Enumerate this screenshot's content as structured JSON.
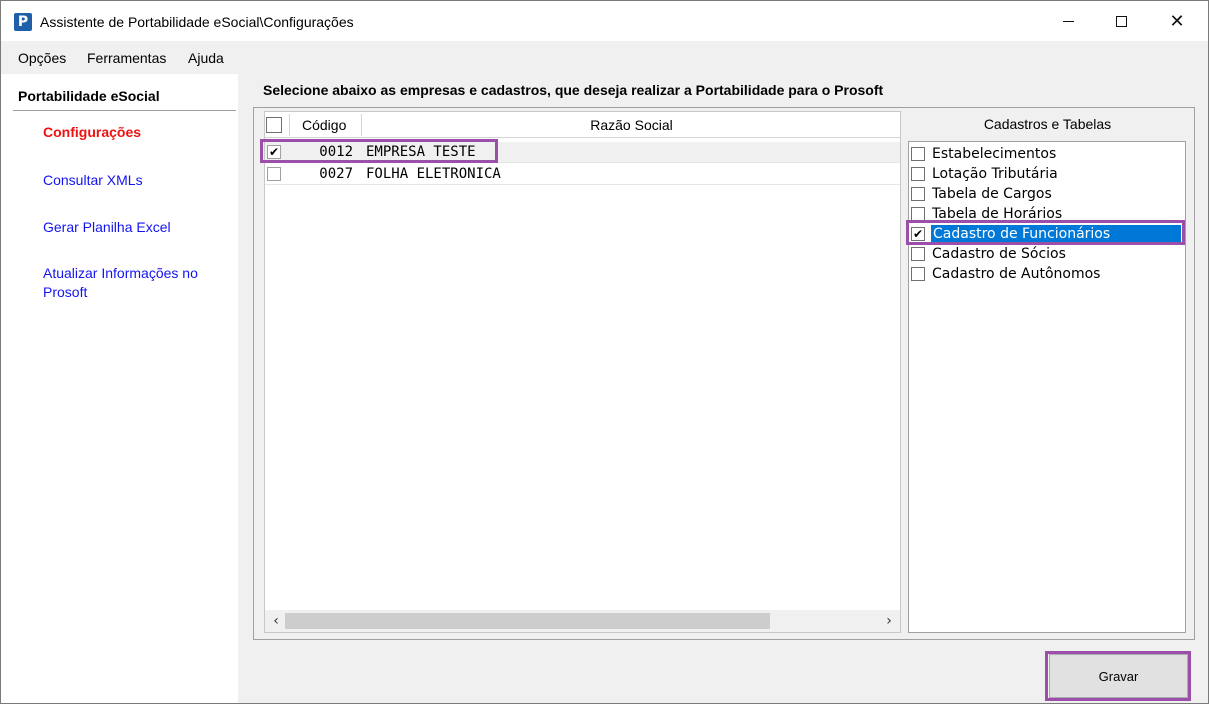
{
  "window": {
    "title": "Assistente de Portabilidade eSocial\\Configurações",
    "icon": "P",
    "close_glyph": "✕"
  },
  "menu": [
    "Opções",
    "Ferramentas",
    "Ajuda"
  ],
  "sidebar": {
    "header": "Portabilidade eSocial",
    "items": [
      {
        "label": "Configurações",
        "active": true
      },
      {
        "label": "Consultar XMLs",
        "active": false
      },
      {
        "label": "Gerar Planilha Excel",
        "active": false
      },
      {
        "label": "Atualizar Informações no Prosoft",
        "active": false
      }
    ]
  },
  "main": {
    "instruction": "Selecione abaixo as empresas e cadastros, que deseja realizar a Portabilidade para o Prosoft",
    "grid": {
      "columns": [
        "Código",
        "Razão Social"
      ],
      "rows": [
        {
          "checked": true,
          "codigo": "0012",
          "razao": "EMPRESA TESTE"
        },
        {
          "checked": false,
          "codigo": "0027",
          "razao": "FOLHA ELETRONICA"
        }
      ],
      "scroll_left": "‹",
      "scroll_right": "›"
    },
    "cadastros": {
      "title": "Cadastros e Tabelas",
      "items": [
        {
          "label": "Estabelecimentos",
          "checked": false
        },
        {
          "label": "Lotação Tributária",
          "checked": false
        },
        {
          "label": "Tabela de Cargos",
          "checked": false
        },
        {
          "label": "Tabela de Horários",
          "checked": false
        },
        {
          "label": "Cadastro de Funcionários",
          "checked": true
        },
        {
          "label": "Cadastro de Sócios",
          "checked": false
        },
        {
          "label": "Cadastro de Autônomos",
          "checked": false
        }
      ]
    },
    "save_label": "Gravar"
  },
  "colors": {
    "active_nav": "#ee1111",
    "link": "#1414f0",
    "highlight": "#9b4fa8",
    "selection": "#0078d7"
  },
  "check_glyph": "✔"
}
